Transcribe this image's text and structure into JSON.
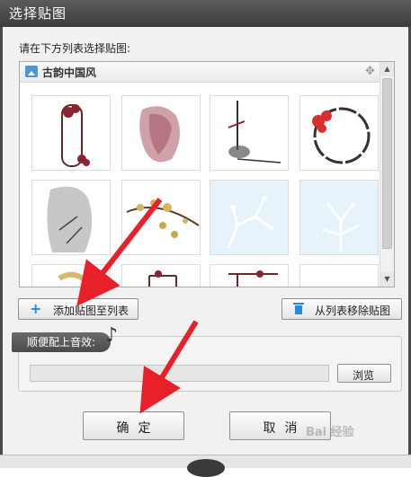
{
  "window": {
    "title": "选择贴图"
  },
  "prompt": "请在下方列表选择贴图:",
  "category": {
    "label": "古韵中国风"
  },
  "thumbnails": [
    {
      "name": "thumb-frame-cloud"
    },
    {
      "name": "thumb-ink-blot"
    },
    {
      "name": "thumb-ink-branch-corner"
    },
    {
      "name": "thumb-round-frame-cloud"
    },
    {
      "name": "thumb-gray-wash"
    },
    {
      "name": "thumb-plum-blossom"
    },
    {
      "name": "thumb-white-plum"
    },
    {
      "name": "thumb-white-coral"
    },
    {
      "name": "thumb-partial-1"
    },
    {
      "name": "thumb-partial-2"
    },
    {
      "name": "thumb-partial-3"
    },
    {
      "name": "thumb-partial-4"
    }
  ],
  "buttons": {
    "add": "添加贴图至列表",
    "remove": "从列表移除贴图",
    "browse": "浏览",
    "ok": "确定",
    "cancel": "取消"
  },
  "music": {
    "label": "顺便配上音效:",
    "path_value": ""
  },
  "watermark": "Bai 经验",
  "colors": {
    "accent": "#2b8bd8",
    "annotation_arrow": "#e8202a",
    "title_bar": "#444444"
  },
  "icons": [
    "image-icon",
    "move-icon",
    "plus-icon",
    "trash-icon",
    "music-note-icon"
  ]
}
